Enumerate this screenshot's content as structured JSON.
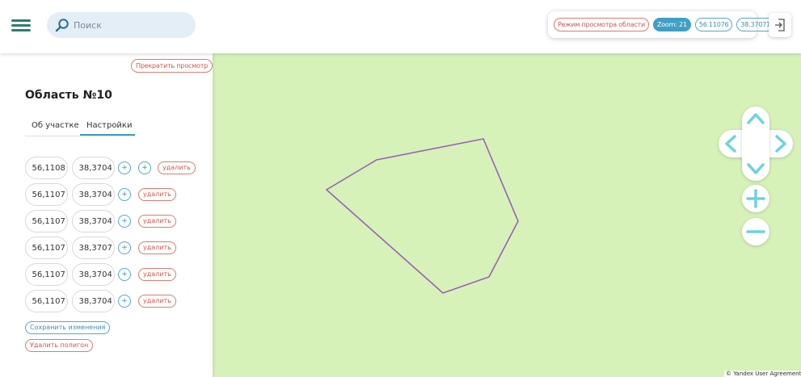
{
  "header": {
    "search_placeholder": "Поиск",
    "status": {
      "mode_label": "Режим просмотра области",
      "zoom_label": "Zoom: 21",
      "latitude": "56.11076",
      "longitude": "38.37071"
    }
  },
  "panel": {
    "stop_button": "Прекратить просмотр",
    "title": "Область №10",
    "tabs": [
      {
        "label": "Об участке",
        "active": false
      },
      {
        "label": "Настройки",
        "active": true
      }
    ],
    "points": [
      {
        "lat": "56,1108",
        "lon": "38,3704",
        "extra_plus": true
      },
      {
        "lat": "56,1107",
        "lon": "38,3704",
        "extra_plus": false
      },
      {
        "lat": "56,1107",
        "lon": "38,3704",
        "extra_plus": false
      },
      {
        "lat": "56,1107",
        "lon": "38,3707",
        "extra_plus": false
      },
      {
        "lat": "56,1107",
        "lon": "38,3704",
        "extra_plus": false
      },
      {
        "lat": "56,1107",
        "lon": "38,3704",
        "extra_plus": false
      }
    ],
    "plus_symbol": "+",
    "delete_label": "удалить",
    "save_button": "Сохранить изменения",
    "delete_polygon_button": "Удалить полигон"
  },
  "map": {
    "copyright": "© Yandex User Agreement",
    "polygon_color": "#9b5fb8"
  },
  "colors": {
    "accent": "#3f9fc4",
    "danger": "#d1574a",
    "map_bg": "#d6f2b8",
    "nav_arrow": "#6dd3e0"
  }
}
